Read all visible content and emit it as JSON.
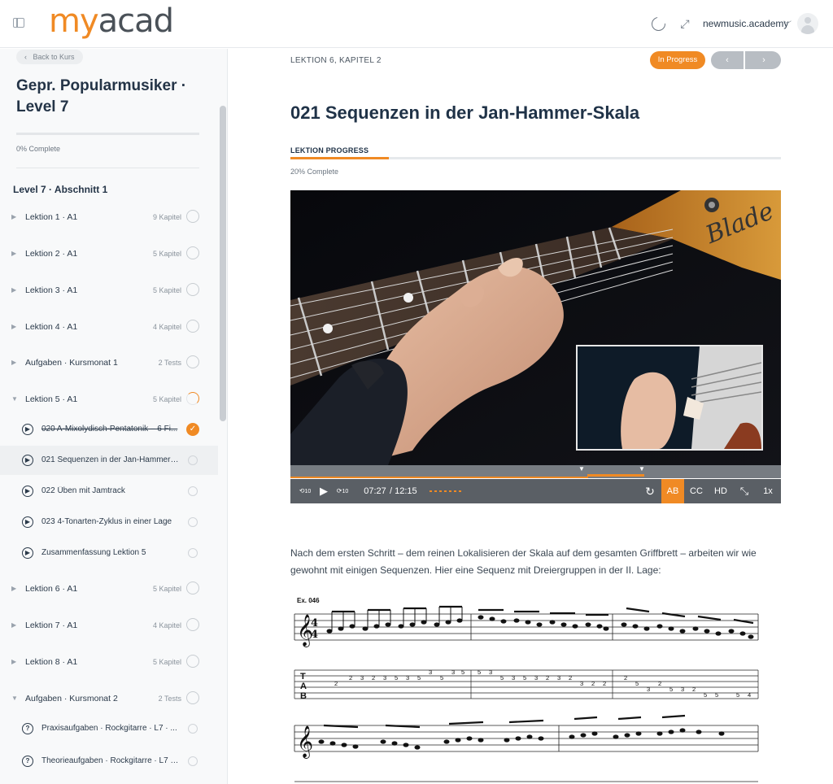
{
  "header": {
    "logo_my": "my",
    "logo_acad": "acad",
    "site_name": "newmusic.academy"
  },
  "sidebar": {
    "back_label": "Back to Kurs",
    "course_title": "Gepr. Popularmusiker · Level 7",
    "course_progress": 0,
    "course_progress_text": "0% Complete",
    "section_title": "Level 7 · Abschnitt 1",
    "lessons_top": [
      {
        "label": "Lektion 1 · A1",
        "count": "9 Kapitel"
      },
      {
        "label": "Lektion 2 · A1",
        "count": "5 Kapitel"
      },
      {
        "label": "Lektion 3 · A1",
        "count": "5 Kapitel"
      },
      {
        "label": "Lektion 4 · A1",
        "count": "4 Kapitel"
      },
      {
        "label": "Aufgaben · Kursmonat 1",
        "count": "2 Tests"
      },
      {
        "label": "Lektion 5 · A1",
        "count": "5 Kapitel"
      }
    ],
    "chapters_l5": [
      {
        "label": "020 A-Mixolydisch-Pentatonik – 6 Fi...",
        "done": true
      },
      {
        "label": "021 Sequenzen in der Jan-Hammer-...",
        "done": false,
        "active": true
      },
      {
        "label": "022 Üben mit Jamtrack",
        "done": false
      },
      {
        "label": "023 4-Tonarten-Zyklus in einer Lage",
        "done": false
      },
      {
        "label": "Zusammenfassung Lektion 5",
        "done": false
      }
    ],
    "lessons_bottom": [
      {
        "label": "Lektion 6 · A1",
        "count": "5 Kapitel"
      },
      {
        "label": "Lektion 7 · A1",
        "count": "4 Kapitel"
      },
      {
        "label": "Lektion 8 · A1",
        "count": "5 Kapitel"
      },
      {
        "label": "Aufgaben · Kursmonat 2",
        "count": "2 Tests"
      }
    ],
    "tests_m2": [
      {
        "label": "Praxisaufgaben · Rockgitarre · L7 · ..."
      },
      {
        "label": "Theorieaufgaben · Rockgitarre · L7 · ..."
      }
    ]
  },
  "main": {
    "breadcrumb": "LEKTION 6, KAPITEL 2",
    "status": "In Progress",
    "prev": "‹",
    "next": "›",
    "title": "021 Sequenzen in der Jan-Hammer-Skala",
    "progress_label": "LEKTION PROGRESS",
    "progress": 0.2,
    "progress_text": "20% Complete",
    "body": "Nach dem ersten Schritt – dem reinen Lokalisieren der Skala auf dem gesamten Griffbrett – arbeiten wir wie gewohnt mit einigen Sequenzen. Hier eine Sequenz mit Dreiergruppen in der II. Lage:"
  },
  "video": {
    "current_time": "07:27",
    "duration": "/ 12:15",
    "played_fraction": 0.607,
    "guitar_brand": "Blade",
    "ab_label": "AB",
    "cc_label": "CC",
    "hd_label": "HD",
    "speed_label": "1x",
    "rewind_label": "10",
    "forward_label": "10"
  },
  "sheet": {
    "example_label": "Ex. 046",
    "time_sig_top": "4",
    "time_sig_bottom": "4",
    "tab_t": "T",
    "tab_a": "A",
    "tab_b": "B"
  },
  "colors": {
    "accent": "#f08a24",
    "text_dark": "#1f3247",
    "control_bar": "#5a5f65"
  }
}
